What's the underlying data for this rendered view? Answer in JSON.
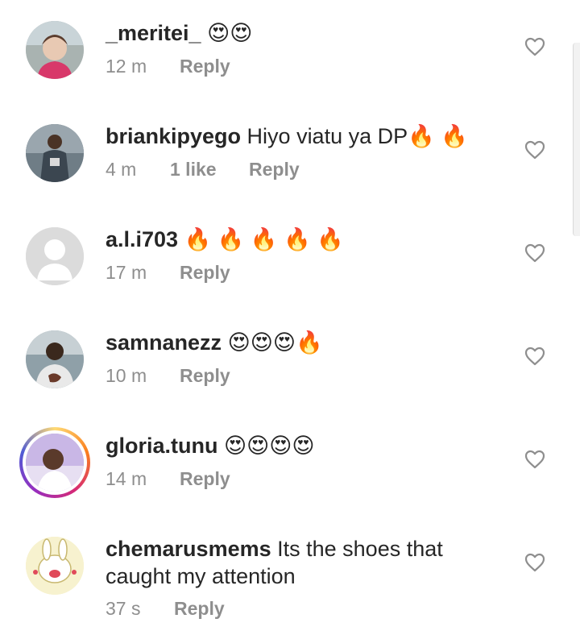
{
  "comments": [
    {
      "username": "_meritei_",
      "text": " 😍😍",
      "time": "12 m",
      "likes": "",
      "reply": "Reply",
      "avatar": "child-photo-avatar"
    },
    {
      "username": "briankipyego",
      "text": " Hiyo viatu ya DP🔥 🔥",
      "time": "4 m",
      "likes": "1 like",
      "reply": "Reply",
      "avatar": "man-photo-avatar"
    },
    {
      "username": "a.l.i703",
      "text": " 🔥 🔥 🔥 🔥 🔥",
      "time": "17 m",
      "likes": "",
      "reply": "Reply",
      "avatar": "default-avatar"
    },
    {
      "username": "samnanezz",
      "text": " 😍😍😍🔥",
      "time": "10 m",
      "likes": "",
      "reply": "Reply",
      "avatar": "man-photo-avatar"
    },
    {
      "username": "gloria.tunu",
      "text": " 😍😍😍😍",
      "time": "14 m",
      "likes": "",
      "reply": "Reply",
      "avatar": "woman-photo-avatar-story"
    },
    {
      "username": "chemarusmems",
      "text": " Its the shoes that caught my attention",
      "time": "37 s",
      "likes": "",
      "reply": "Reply",
      "avatar": "cartoon-rabbit-avatar"
    }
  ],
  "icons": {
    "like": "heart-outline-icon"
  },
  "colors": {
    "text": "#262626",
    "meta": "#8e8e8e",
    "story_ring": "#d62976"
  }
}
